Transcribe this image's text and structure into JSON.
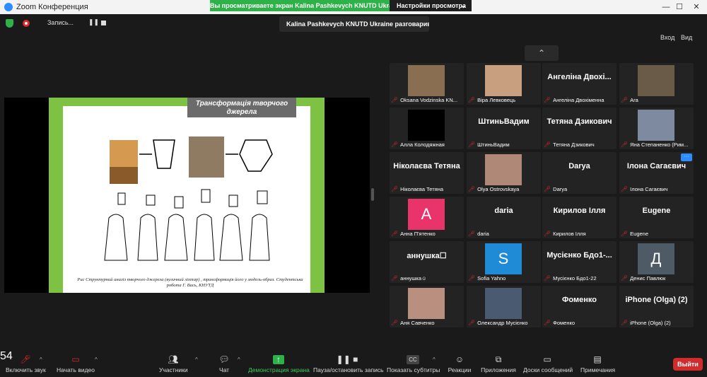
{
  "window": {
    "title": "Zoom Конференция",
    "minimize": "—",
    "maximize": "☐",
    "close": "✕"
  },
  "share_banner": "Вы просматриваете экран Kalina Pashkevych KNUTD Ukraine",
  "view_options": "Настройки просмотра",
  "recording": {
    "label": "Запись...",
    "pause": "❚❚"
  },
  "speaker_notice": "Kalina Pashkevych KNUTD Ukraine разговаривает...",
  "view_controls": {
    "exit_label": "Вход",
    "view_label": "Вид"
  },
  "slide": {
    "title": "Трансформація творчого джерела",
    "caption": "Рис Структурний аналіз творчого джерела (вуличний ліхтар) , трансформація його у модель-образ. Студентська робота Г. Вась, КНУТД"
  },
  "participants": [
    {
      "big": "",
      "label": "Oksana Vodzinska KN...",
      "kind": "photo",
      "color": "#8a6e52"
    },
    {
      "big": "",
      "label": "Віра Левковець",
      "kind": "photo",
      "color": "#c8a080"
    },
    {
      "big": "Ангеліна Двохі...",
      "label": "Ангеліна Двохіменна",
      "kind": "name"
    },
    {
      "big": "",
      "label": "Ara",
      "kind": "photo",
      "color": "#6a5a48"
    },
    {
      "big": "",
      "label": "Алла Колодяжная",
      "kind": "black"
    },
    {
      "big": "ШтиньВадим",
      "label": "ШтиньВадим",
      "kind": "name"
    },
    {
      "big": "Тетяна Дзикович",
      "label": "Тетяна Дзикович",
      "kind": "name"
    },
    {
      "big": "",
      "label": "Яна Степаненко (Рим...",
      "kind": "photo",
      "color": "#7d8aa0"
    },
    {
      "big": "Ніколаєва Тетяна",
      "label": "Ніколаєва Тетяна",
      "kind": "name"
    },
    {
      "big": "",
      "label": "Olya Ostrovskaya",
      "kind": "photo",
      "color": "#b08878"
    },
    {
      "big": "Darya",
      "label": "Darya",
      "kind": "name"
    },
    {
      "big": "Ілона Сагаєвич",
      "label": "Ілона Сагаєвич",
      "kind": "name",
      "more": "···"
    },
    {
      "big": "",
      "label": "Анна П'ятенко",
      "kind": "avatar",
      "letter": "A",
      "color": "#e8336b"
    },
    {
      "big": "daria",
      "label": "daria",
      "kind": "name"
    },
    {
      "big": "Кирилов Ілля",
      "label": "Кирилов Ілля",
      "kind": "name"
    },
    {
      "big": "Eugene",
      "label": "Eugene",
      "kind": "name"
    },
    {
      "big": "аннушка☐",
      "label": "аннушка☺",
      "kind": "name"
    },
    {
      "big": "",
      "label": "Sofia Yahno",
      "kind": "avatar",
      "letter": "S",
      "color": "#1f8ad6"
    },
    {
      "big": "Мусієнко Бдо1-...",
      "label": "Мусієнко Бдо1-22",
      "kind": "name"
    },
    {
      "big": "",
      "label": "Денис Павлюк",
      "kind": "avatar",
      "letter": "Д",
      "color": "#4e5a66"
    },
    {
      "big": "",
      "label": "Аня Савченко",
      "kind": "photo",
      "color": "#b99080"
    },
    {
      "big": "",
      "label": "Олександр Мусієнко",
      "kind": "photo",
      "color": "#4a5a70"
    },
    {
      "big": "Фоменко",
      "label": "Фоменко",
      "kind": "name"
    },
    {
      "big": "iPhone (Olga) (2)",
      "label": "iPhone (Olga) (2)",
      "kind": "name"
    }
  ],
  "toolbar": {
    "mute": "Включить звук",
    "video": "Начать видео",
    "participants": "Участники",
    "participants_count": "54",
    "chat": "Чат",
    "share": "Демонстрация экрана",
    "pause_rec": "Пауза/остановить запись",
    "captions": "Показать субтитры",
    "reactions": "Реакции",
    "apps": "Приложения",
    "whiteboards": "Доски сообщений",
    "notes": "Примечания",
    "leave": "Выйти"
  }
}
